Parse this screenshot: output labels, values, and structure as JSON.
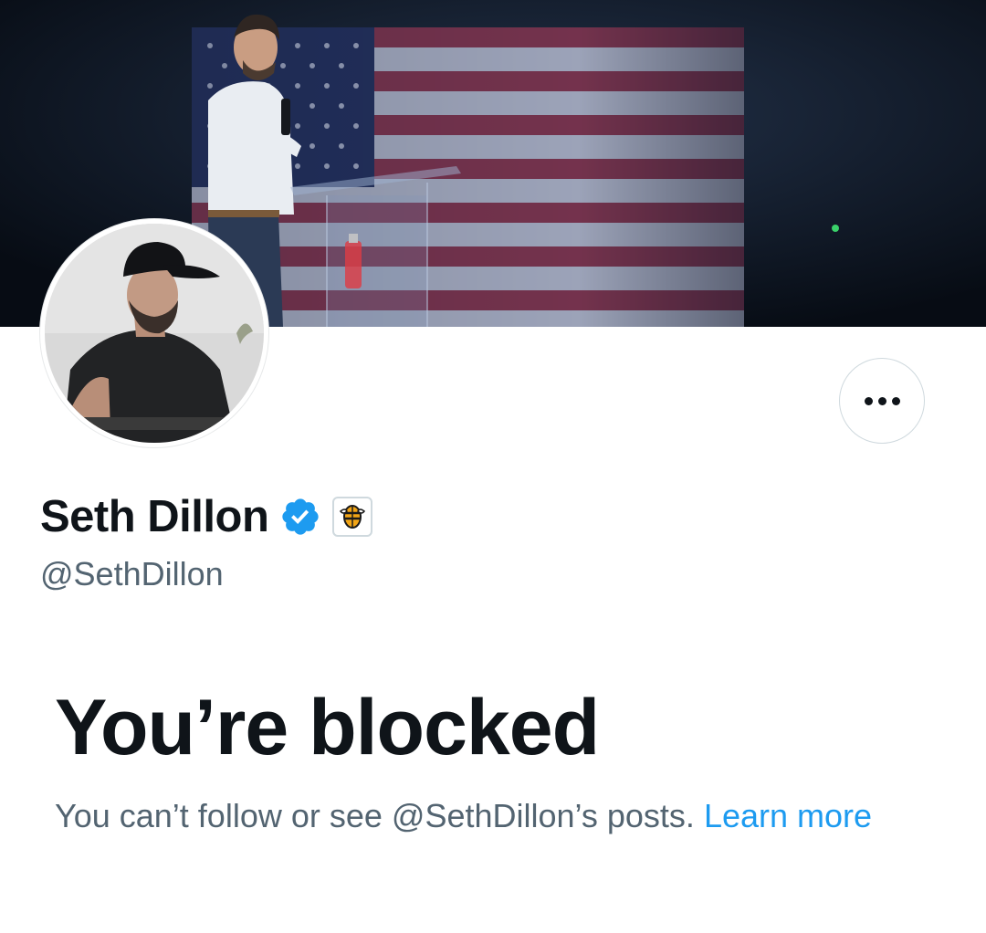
{
  "profile": {
    "display_name": "Seth Dillon",
    "handle": "@SethDillon",
    "verified": true,
    "verified_color": "#1d9bf0",
    "affiliation_badge": "babylon-bee-badge-icon"
  },
  "actions": {
    "more_icon": "more-horizontal-icon"
  },
  "blocked": {
    "title": "You’re blocked",
    "message": "You can’t follow or see @SethDillon’s posts.",
    "link_label": "Learn more",
    "link_color": "#1d9bf0"
  },
  "colors": {
    "primary_text": "#0f1419",
    "secondary_text": "#536471",
    "accent": "#1d9bf0"
  }
}
